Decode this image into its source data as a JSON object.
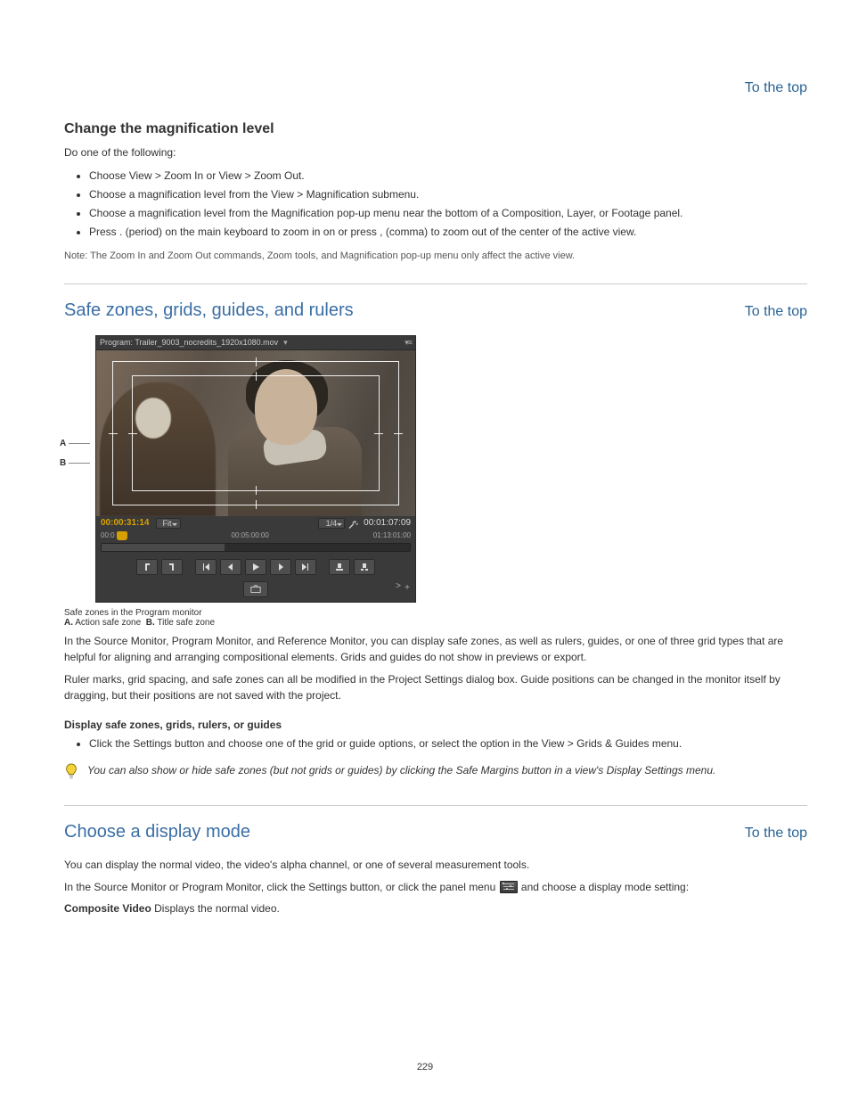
{
  "top_link": {
    "label": "To the top",
    "href": "#top"
  },
  "section1": {
    "heading": "Change the magnification level",
    "intro": "Do one of the following:",
    "bullets": [
      "Choose View > Zoom In or View > Zoom Out.",
      "Choose a magnification level from the View > Magnification submenu.",
      "Choose a magnification level from the Magnification pop-up menu near the bottom of a Composition, Layer, or Footage panel.",
      "Press . (period) on the main keyboard to zoom in on or press , (comma) to zoom out of the center of the active view."
    ],
    "note": "Note: The Zoom In and Zoom Out commands, Zoom tools, and Magnification pop-up menu only affect the active view."
  },
  "section2": {
    "heading": "Safe zones, grids, guides, and rulers",
    "monitor": {
      "title": "Program: Trailer_9003_nocredits_1920x1080.mov",
      "tc_left": "00:00:31:14",
      "fit_label": "Fit",
      "scale_label": "1/4",
      "tc_right": "00:01:07:09",
      "ruler_left": "00:0",
      "ruler_mid": "00:05:00:00",
      "ruler_right": "01:13:01:00"
    },
    "caption_lead": "Safe zones in the Program monitor",
    "caption_items": [
      {
        "key": "A.",
        "text": "Action safe zone"
      },
      {
        "key": "B.",
        "text": "Title safe zone"
      }
    ],
    "para1": "In the Source Monitor, Program Monitor, and Reference Monitor, you can display safe zones, as well as rulers, guides, or one of three grid types that are helpful for aligning and arranging compositional elements. Grids and guides do not show in previews or export.",
    "para2": "Ruler marks, grid spacing, and safe zones can all be modified in the Project Settings dialog box. Guide positions can be changed in the monitor itself by dragging, but their positions are not saved with the project.",
    "sub1": {
      "heading": "Display safe zones, grids, rulers, or guides",
      "bullet": "Click the Settings button and choose one of the grid or guide options, or select the option in the View > Grids & Guides menu."
    },
    "tip": "You can also show or hide safe zones (but not grids or guides) by clicking the Safe Margins button in a view's Display Settings menu.",
    "section3": {
      "heading": "Choose a display mode",
      "p1": "You can display the normal video, the video's alpha channel, or one of several measurement tools.",
      "p2_pre": "In the Source Monitor or Program Monitor, click the Settings button, or click the panel menu ",
      "p2_post": " and choose a display mode setting:",
      "composite_label": "Composite Video",
      "composite_text": " Displays the normal video."
    }
  },
  "page_number": "229"
}
